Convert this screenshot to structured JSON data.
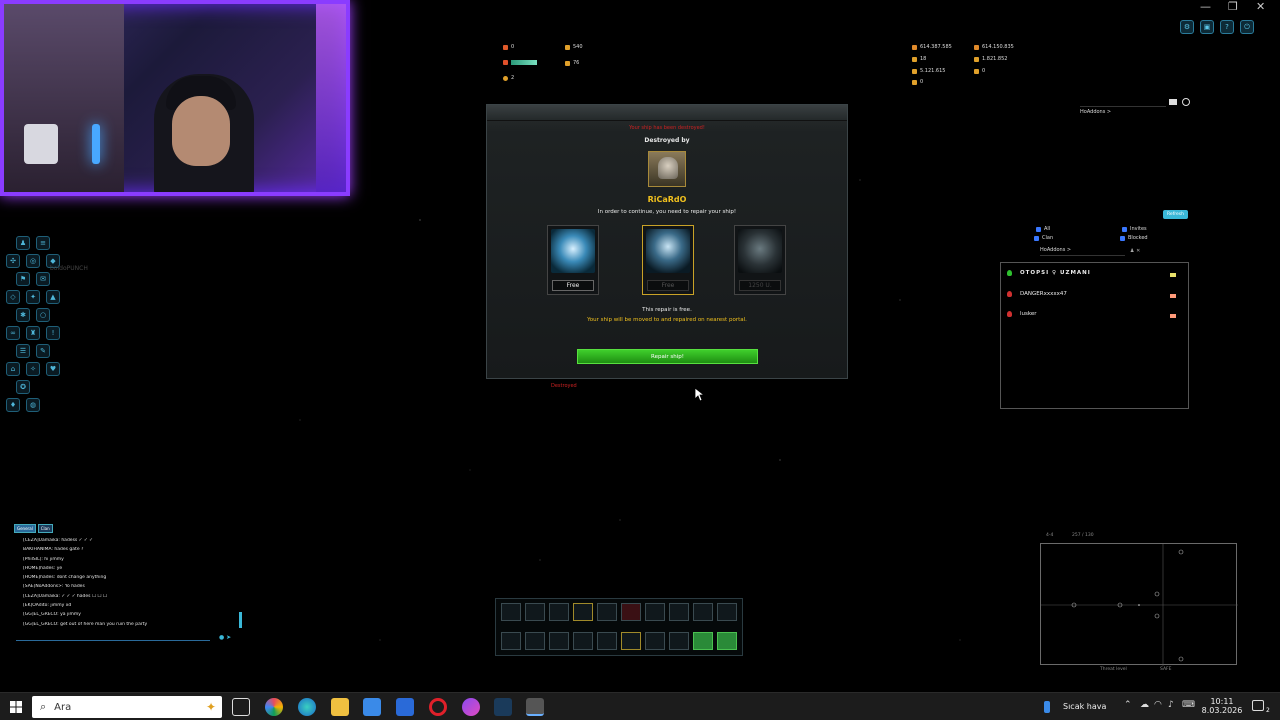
{
  "top_stats_left": [
    {
      "icon": "crossed-swords-icon",
      "value": "0",
      "color": "#e05a2a"
    },
    {
      "icon": "shield-icon",
      "value": "540",
      "color": "#e0a02a"
    },
    {
      "icon": "heart-icon",
      "value": "",
      "color": "#e0502a",
      "bar": true
    },
    {
      "icon": "box-icon",
      "value": "76",
      "color": "#e0a02a"
    },
    {
      "icon": "coin-icon",
      "value": "2",
      "color": "#e0a02a"
    }
  ],
  "top_stats_right": [
    {
      "icon": "credits-icon",
      "value": "614.387.585",
      "color": "#e08a2a"
    },
    {
      "icon": "uridium-icon",
      "value": "614.150.835",
      "color": "#e08a2a"
    },
    {
      "icon": "level-icon",
      "value": "18",
      "color": "#e0a02a"
    },
    {
      "icon": "honor-icon",
      "value": "1.821.852",
      "color": "#e0a02a"
    },
    {
      "icon": "rank-icon",
      "value": "5.121.615",
      "color": "#e0a02a"
    },
    {
      "icon": "experience-icon",
      "value": "0",
      "color": "#e0a02a"
    },
    {
      "icon": "jackpot-icon",
      "value": "0",
      "color": "#e0a02a"
    }
  ],
  "dialog": {
    "header_red": "Your ship has been destroyed!",
    "destroyed_by_label": "Destroyed by",
    "killer_name": "RiCaRdO",
    "instruction": "In order to continue, you need to repair your ship!",
    "options": [
      {
        "label": "Free",
        "state": "normal"
      },
      {
        "label": "Free",
        "state": "selected"
      },
      {
        "label": "1250 U.",
        "state": "dim"
      }
    ],
    "free_text": "This repair is free.",
    "move_text": "Your ship will be moved to and repaired on nearest portal.",
    "repair_button": "Repair ship!"
  },
  "under_dialog_red": "Destroyed",
  "left_panel_faded_name": "boldoPUNCH",
  "search_top_right": {
    "placeholder": "HoAddons >"
  },
  "friends_filter": {
    "refresh_label": "Refresh",
    "checks": [
      "All",
      "Invites",
      "Clan",
      "Blocked"
    ],
    "search_value": "HoAddons >"
  },
  "players": [
    {
      "name": "OTOPSI ♀ UZMANI",
      "status_color": "#2ec02e",
      "mail_color": "#e8e06a"
    },
    {
      "name": "DANGERxxxxx47",
      "status_color": "#d03030",
      "mail_color": "#ff9a7a"
    },
    {
      "name": "lusker",
      "status_color": "#d03030",
      "mail_color": "#ff9a7a"
    }
  ],
  "chat": {
    "tabs": [
      "General",
      "Clan"
    ],
    "lines": [
      "[CEZA]Uamaika: hadess ✓ ✓ ✓",
      "BAKIHANIMA: hades gate ?",
      "[PhiISIL]: hi jimmy",
      "[HOME]hades: ye",
      "[HOME]hades: dont change anything",
      "[SAE]NoAddons>: Yo hades",
      "[CEZA]Uamaika: ✓ ✓ ✓ hades ☐ ☐ ☐",
      "[EK]OAdito: jimmy xd",
      "[GG]EL_GRECO: ya jimmy",
      "[GG]EL_GRECO: get out of here man you ruin the party"
    ]
  },
  "minimap": {
    "sector": "4-4",
    "coords": "257 / 130",
    "threat_label": "Threat level",
    "threat_value": "SAFE"
  },
  "taskbar": {
    "search_placeholder": "Ara",
    "weather": "Sıcak hava",
    "time": "10:11",
    "date": "8.03.2026",
    "notification_count": "2"
  }
}
